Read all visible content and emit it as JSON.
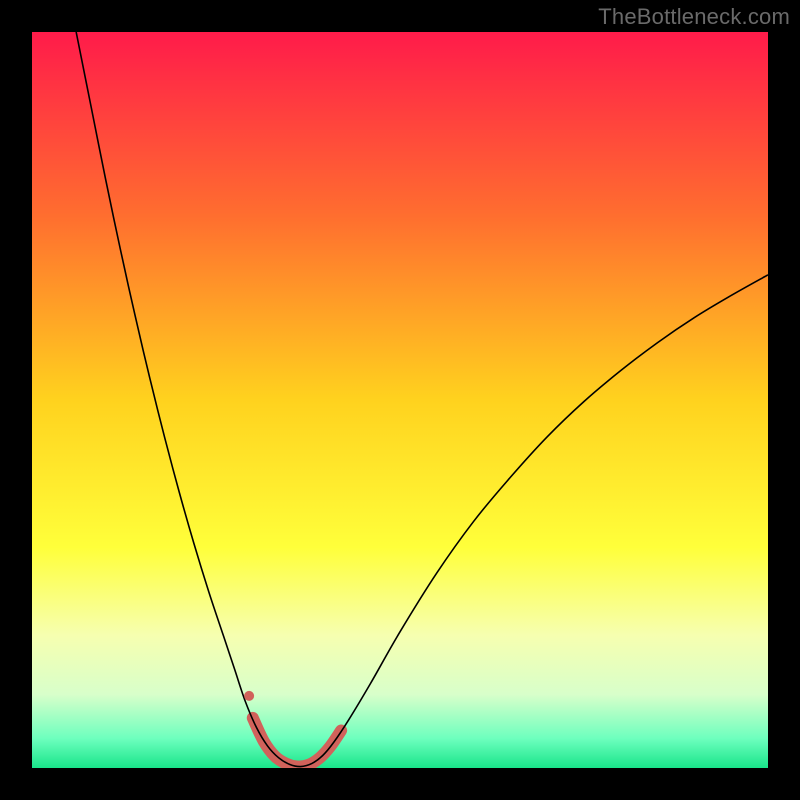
{
  "watermark": "TheBottleneck.com",
  "chart_data": {
    "type": "line",
    "title": "",
    "xlabel": "",
    "ylabel": "",
    "xlim": [
      0,
      100
    ],
    "ylim": [
      0,
      100
    ],
    "background_gradient": {
      "stops": [
        {
          "offset": 0.0,
          "color": "#ff1b4a"
        },
        {
          "offset": 0.25,
          "color": "#ff6e2f"
        },
        {
          "offset": 0.5,
          "color": "#ffd21e"
        },
        {
          "offset": 0.7,
          "color": "#ffff3a"
        },
        {
          "offset": 0.82,
          "color": "#f6ffb0"
        },
        {
          "offset": 0.9,
          "color": "#d8ffca"
        },
        {
          "offset": 0.96,
          "color": "#6dffbe"
        },
        {
          "offset": 1.0,
          "color": "#19e58a"
        }
      ]
    },
    "series": [
      {
        "name": "main-curve",
        "stroke": "#000000",
        "stroke_width": 1.6,
        "points": [
          {
            "x": 6.0,
            "y": 100.0
          },
          {
            "x": 8.0,
            "y": 90.0
          },
          {
            "x": 10.0,
            "y": 80.0
          },
          {
            "x": 12.0,
            "y": 70.5
          },
          {
            "x": 14.0,
            "y": 61.5
          },
          {
            "x": 16.0,
            "y": 53.0
          },
          {
            "x": 18.0,
            "y": 45.0
          },
          {
            "x": 20.0,
            "y": 37.5
          },
          {
            "x": 22.0,
            "y": 30.5
          },
          {
            "x": 24.0,
            "y": 24.0
          },
          {
            "x": 26.0,
            "y": 18.0
          },
          {
            "x": 27.5,
            "y": 13.5
          },
          {
            "x": 29.0,
            "y": 9.0
          },
          {
            "x": 30.5,
            "y": 5.5
          },
          {
            "x": 32.0,
            "y": 3.0
          },
          {
            "x": 33.5,
            "y": 1.4
          },
          {
            "x": 35.0,
            "y": 0.5
          },
          {
            "x": 36.5,
            "y": 0.2
          },
          {
            "x": 38.0,
            "y": 0.6
          },
          {
            "x": 39.5,
            "y": 1.7
          },
          {
            "x": 41.0,
            "y": 3.5
          },
          {
            "x": 43.0,
            "y": 6.5
          },
          {
            "x": 46.0,
            "y": 11.5
          },
          {
            "x": 50.0,
            "y": 18.5
          },
          {
            "x": 55.0,
            "y": 26.5
          },
          {
            "x": 60.0,
            "y": 33.5
          },
          {
            "x": 65.0,
            "y": 39.5
          },
          {
            "x": 70.0,
            "y": 45.0
          },
          {
            "x": 75.0,
            "y": 49.8
          },
          {
            "x": 80.0,
            "y": 54.0
          },
          {
            "x": 85.0,
            "y": 57.8
          },
          {
            "x": 90.0,
            "y": 61.2
          },
          {
            "x": 95.0,
            "y": 64.2
          },
          {
            "x": 100.0,
            "y": 67.0
          }
        ]
      },
      {
        "name": "highlight-band",
        "stroke": "#d1625b",
        "stroke_width": 12,
        "linecap": "round",
        "points": [
          {
            "x": 30.0,
            "y": 6.8
          },
          {
            "x": 31.5,
            "y": 3.6
          },
          {
            "x": 33.0,
            "y": 1.6
          },
          {
            "x": 34.5,
            "y": 0.6
          },
          {
            "x": 36.0,
            "y": 0.2
          },
          {
            "x": 37.5,
            "y": 0.4
          },
          {
            "x": 39.0,
            "y": 1.3
          },
          {
            "x": 40.5,
            "y": 2.9
          },
          {
            "x": 42.0,
            "y": 5.1
          }
        ]
      }
    ],
    "markers": [
      {
        "name": "highlight-dot",
        "x": 29.5,
        "y": 9.8,
        "r": 5,
        "fill": "#d1625b"
      }
    ]
  }
}
